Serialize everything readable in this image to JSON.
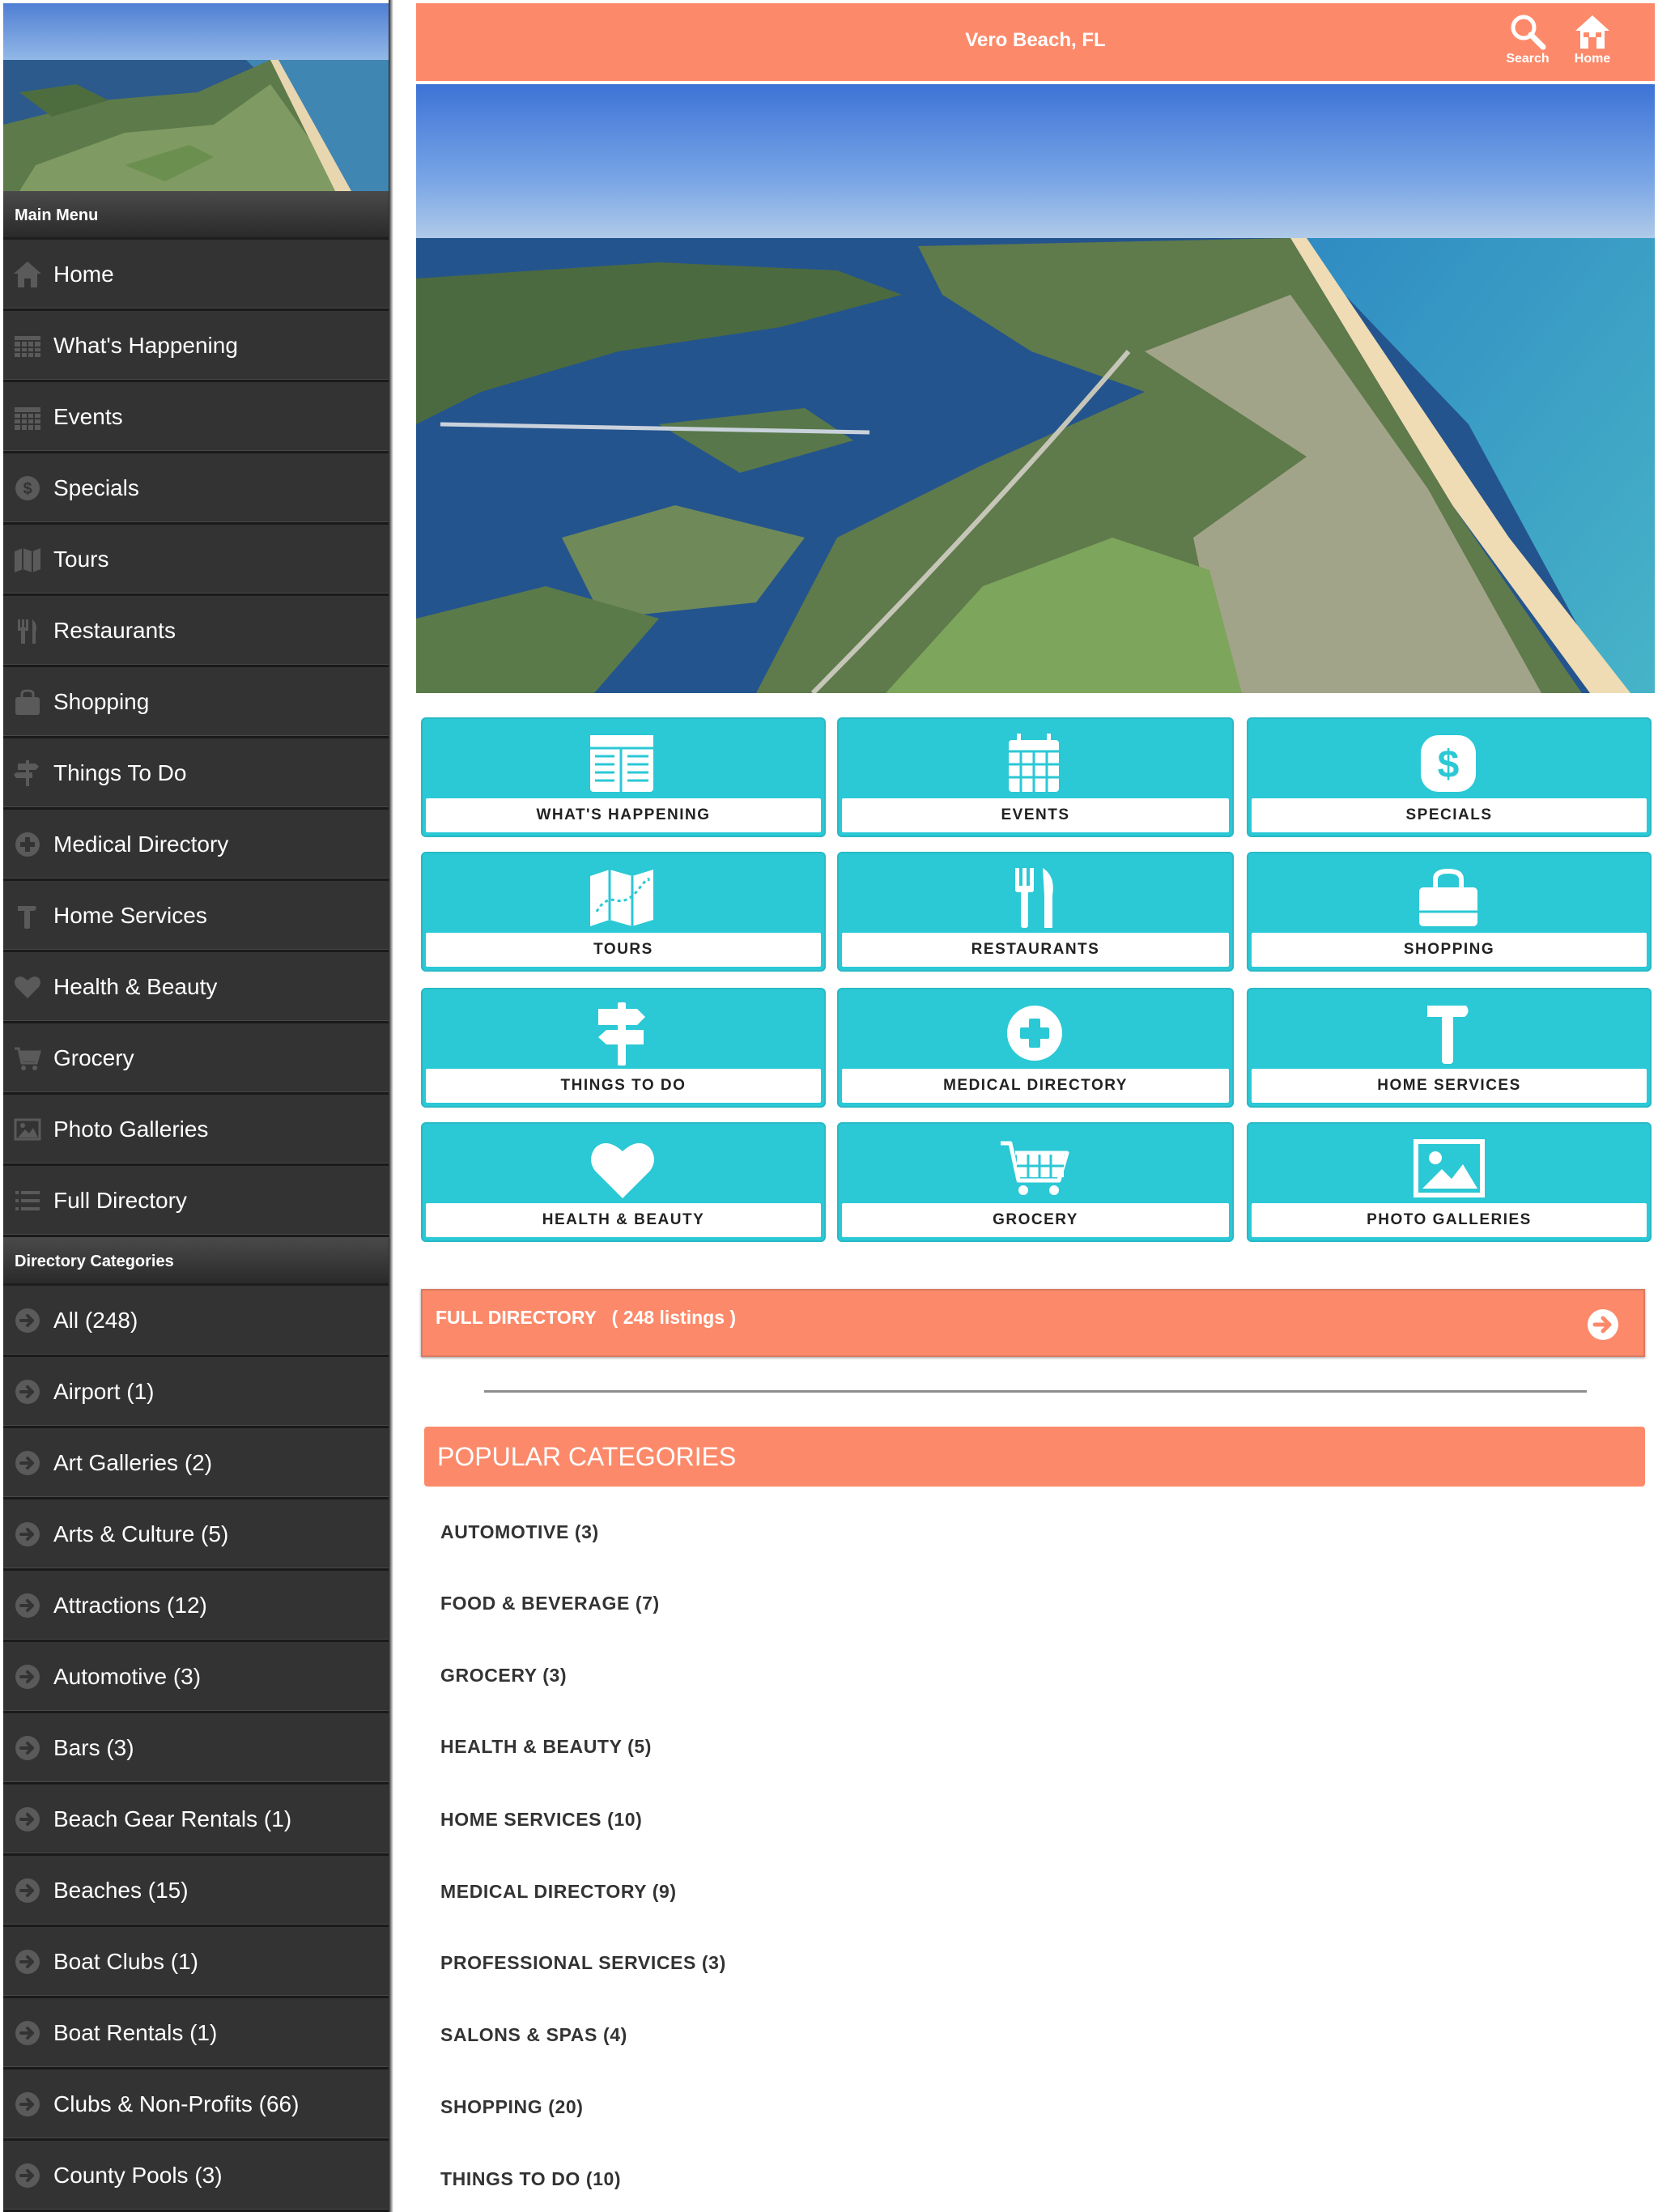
{
  "header": {
    "title": "Vero Beach, FL",
    "search_label": "Search",
    "home_label": "Home"
  },
  "colors": {
    "accent": "#fc8a6a",
    "tile": "#2bc8d5",
    "sidebar": "#333333"
  },
  "sidebar": {
    "main_menu_title": "Main Menu",
    "main_menu": [
      {
        "label": "Home",
        "icon": "home-icon"
      },
      {
        "label": "What's Happening",
        "icon": "newspaper-icon"
      },
      {
        "label": "Events",
        "icon": "calendar-icon"
      },
      {
        "label": "Specials",
        "icon": "dollar-icon"
      },
      {
        "label": "Tours",
        "icon": "map-icon"
      },
      {
        "label": "Restaurants",
        "icon": "utensils-icon"
      },
      {
        "label": "Shopping",
        "icon": "bag-icon"
      },
      {
        "label": "Things To Do",
        "icon": "signpost-icon"
      },
      {
        "label": "Medical Directory",
        "icon": "plus-circle-icon"
      },
      {
        "label": "Home Services",
        "icon": "hammer-icon"
      },
      {
        "label": "Health & Beauty",
        "icon": "heart-icon"
      },
      {
        "label": "Grocery",
        "icon": "cart-icon"
      },
      {
        "label": "Photo Galleries",
        "icon": "picture-icon"
      },
      {
        "label": "Full Directory",
        "icon": "list-icon"
      }
    ],
    "categories_title": "Directory Categories",
    "categories": [
      {
        "label": "All (248)"
      },
      {
        "label": "Airport (1)"
      },
      {
        "label": "Art Galleries (2)"
      },
      {
        "label": "Arts & Culture (5)"
      },
      {
        "label": "Attractions (12)"
      },
      {
        "label": "Automotive (3)"
      },
      {
        "label": "Bars (3)"
      },
      {
        "label": "Beach Gear Rentals (1)"
      },
      {
        "label": "Beaches (15)"
      },
      {
        "label": "Boat Clubs (1)"
      },
      {
        "label": "Boat Rentals (1)"
      },
      {
        "label": "Clubs & Non-Profits (66)"
      },
      {
        "label": "County Pools (3)"
      }
    ]
  },
  "tiles": [
    {
      "label": "WHAT'S HAPPENING",
      "icon": "newspaper-icon"
    },
    {
      "label": "EVENTS",
      "icon": "calendar-icon"
    },
    {
      "label": "SPECIALS",
      "icon": "dollar-icon"
    },
    {
      "label": "TOURS",
      "icon": "map-icon"
    },
    {
      "label": "RESTAURANTS",
      "icon": "utensils-icon"
    },
    {
      "label": "SHOPPING",
      "icon": "bag-icon"
    },
    {
      "label": "THINGS TO DO",
      "icon": "signpost-icon"
    },
    {
      "label": "MEDICAL DIRECTORY",
      "icon": "plus-circle-icon"
    },
    {
      "label": "HOME SERVICES",
      "icon": "hammer-icon"
    },
    {
      "label": "HEALTH & BEAUTY",
      "icon": "heart-icon"
    },
    {
      "label": "GROCERY",
      "icon": "cart-icon"
    },
    {
      "label": "PHOTO GALLERIES",
      "icon": "picture-icon"
    }
  ],
  "full_directory": {
    "label": "FULL DIRECTORY   ( 248 listings )"
  },
  "popular": {
    "title": "POPULAR CATEGORIES",
    "items": [
      {
        "label": "AUTOMOTIVE (3)"
      },
      {
        "label": "FOOD & BEVERAGE (7)"
      },
      {
        "label": "GROCERY (3)"
      },
      {
        "label": "HEALTH & BEAUTY (5)"
      },
      {
        "label": "HOME SERVICES (10)"
      },
      {
        "label": "MEDICAL DIRECTORY (9)"
      },
      {
        "label": "PROFESSIONAL SERVICES (3)"
      },
      {
        "label": "SALONS & SPAS (4)"
      },
      {
        "label": "SHOPPING (20)"
      },
      {
        "label": "THINGS TO DO (10)"
      }
    ]
  }
}
